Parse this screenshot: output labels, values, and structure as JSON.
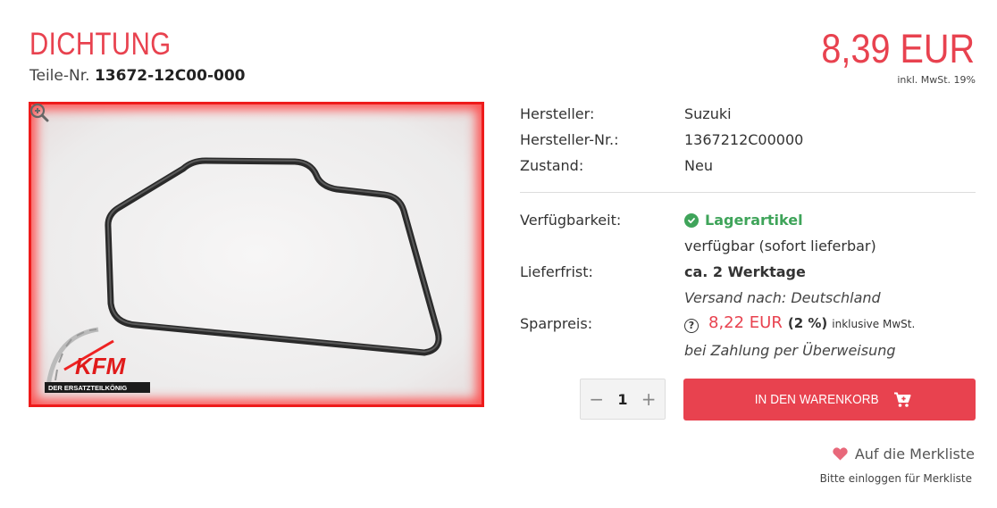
{
  "product": {
    "title": "DICHTUNG",
    "part_no_label": "Teile-Nr.",
    "part_no": "13672-12C00-000",
    "price": "8,39 EUR",
    "vat_note": "inkl. MwSt. 19%"
  },
  "image": {
    "logo_text": "KFM",
    "logo_subtext": "DER ERSATZTEILKÖNIG",
    "zoom_icon": "zoom-in-icon"
  },
  "attributes": {
    "manufacturer_label": "Hersteller:",
    "manufacturer": "Suzuki",
    "manufacturer_no_label": "Hersteller-Nr.:",
    "manufacturer_no": "1367212C00000",
    "condition_label": "Zustand:",
    "condition": "Neu"
  },
  "availability": {
    "label": "Verfügbarkeit:",
    "status": "Lagerartikel",
    "status_color": "#3fa45a",
    "note": "verfügbar (sofort lieferbar)"
  },
  "delivery": {
    "label": "Lieferfrist:",
    "value": "ca. 2 Werktage",
    "shipping": "Versand nach: Deutschland"
  },
  "savings": {
    "label": "Sparpreis:",
    "price": "8,22 EUR",
    "percent": "(2 %)",
    "vat": "inklusive MwSt.",
    "condition": "bei Zahlung per Überweisung"
  },
  "cart": {
    "quantity": "1",
    "minus": "−",
    "plus": "+",
    "button_label": "IN DEN WARENKORB"
  },
  "wishlist": {
    "label": "Auf die Merkliste",
    "note": "Bitte einloggen für Merkliste"
  },
  "colors": {
    "accent": "#e8424f",
    "success": "#3fa45a"
  }
}
